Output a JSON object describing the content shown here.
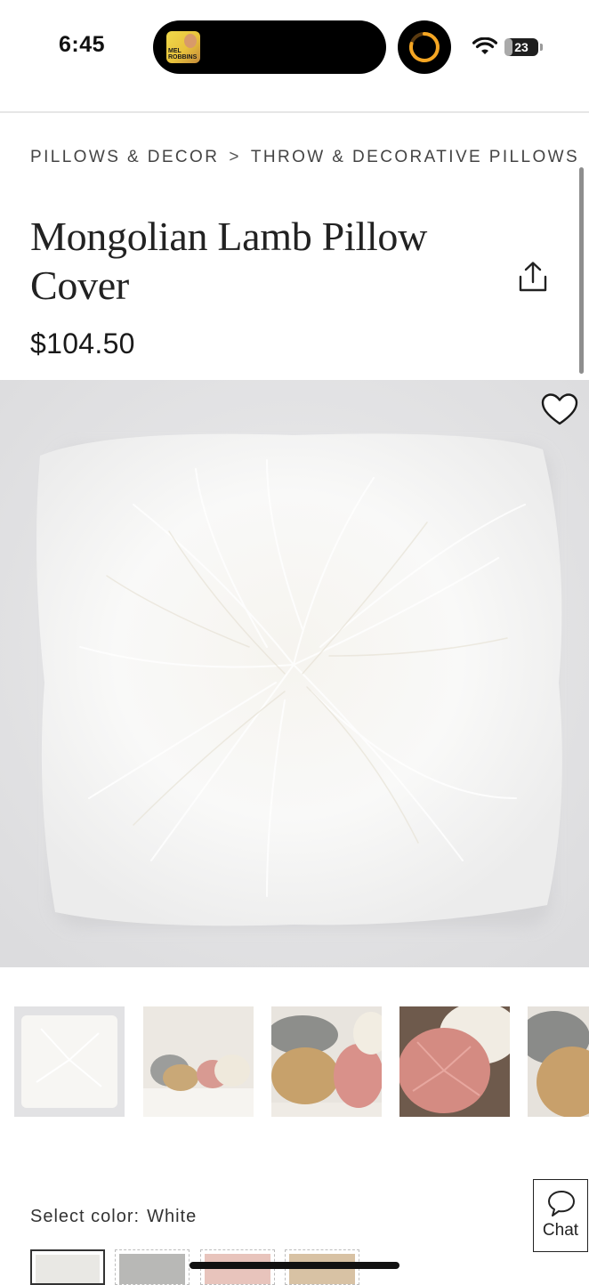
{
  "status_bar": {
    "time": "6:45",
    "now_playing_thumb_text": "MEL ROBBINS",
    "battery_level": "23",
    "battery_fraction": 0.23,
    "accent_timer_color": "#f5a623"
  },
  "breadcrumb": {
    "items": [
      "PILLOWS & DECOR",
      "THROW & DECORATIVE PILLOWS"
    ],
    "separator": ">"
  },
  "product": {
    "title": "Mongolian Lamb Pillow Cover",
    "price": "$104.50"
  },
  "icons": {
    "share": "share-icon",
    "favorite": "heart-icon",
    "chat": "chat-bubble-icon"
  },
  "gallery": {
    "image_count": 5,
    "selected_index": 0
  },
  "color_selector": {
    "label": "Select color:",
    "selected": "White",
    "swatch_colors": [
      "#e9e8e4",
      "#b8b8b6",
      "#e8c4bc",
      "#d8c2a4"
    ]
  },
  "chat": {
    "label": "Chat"
  }
}
